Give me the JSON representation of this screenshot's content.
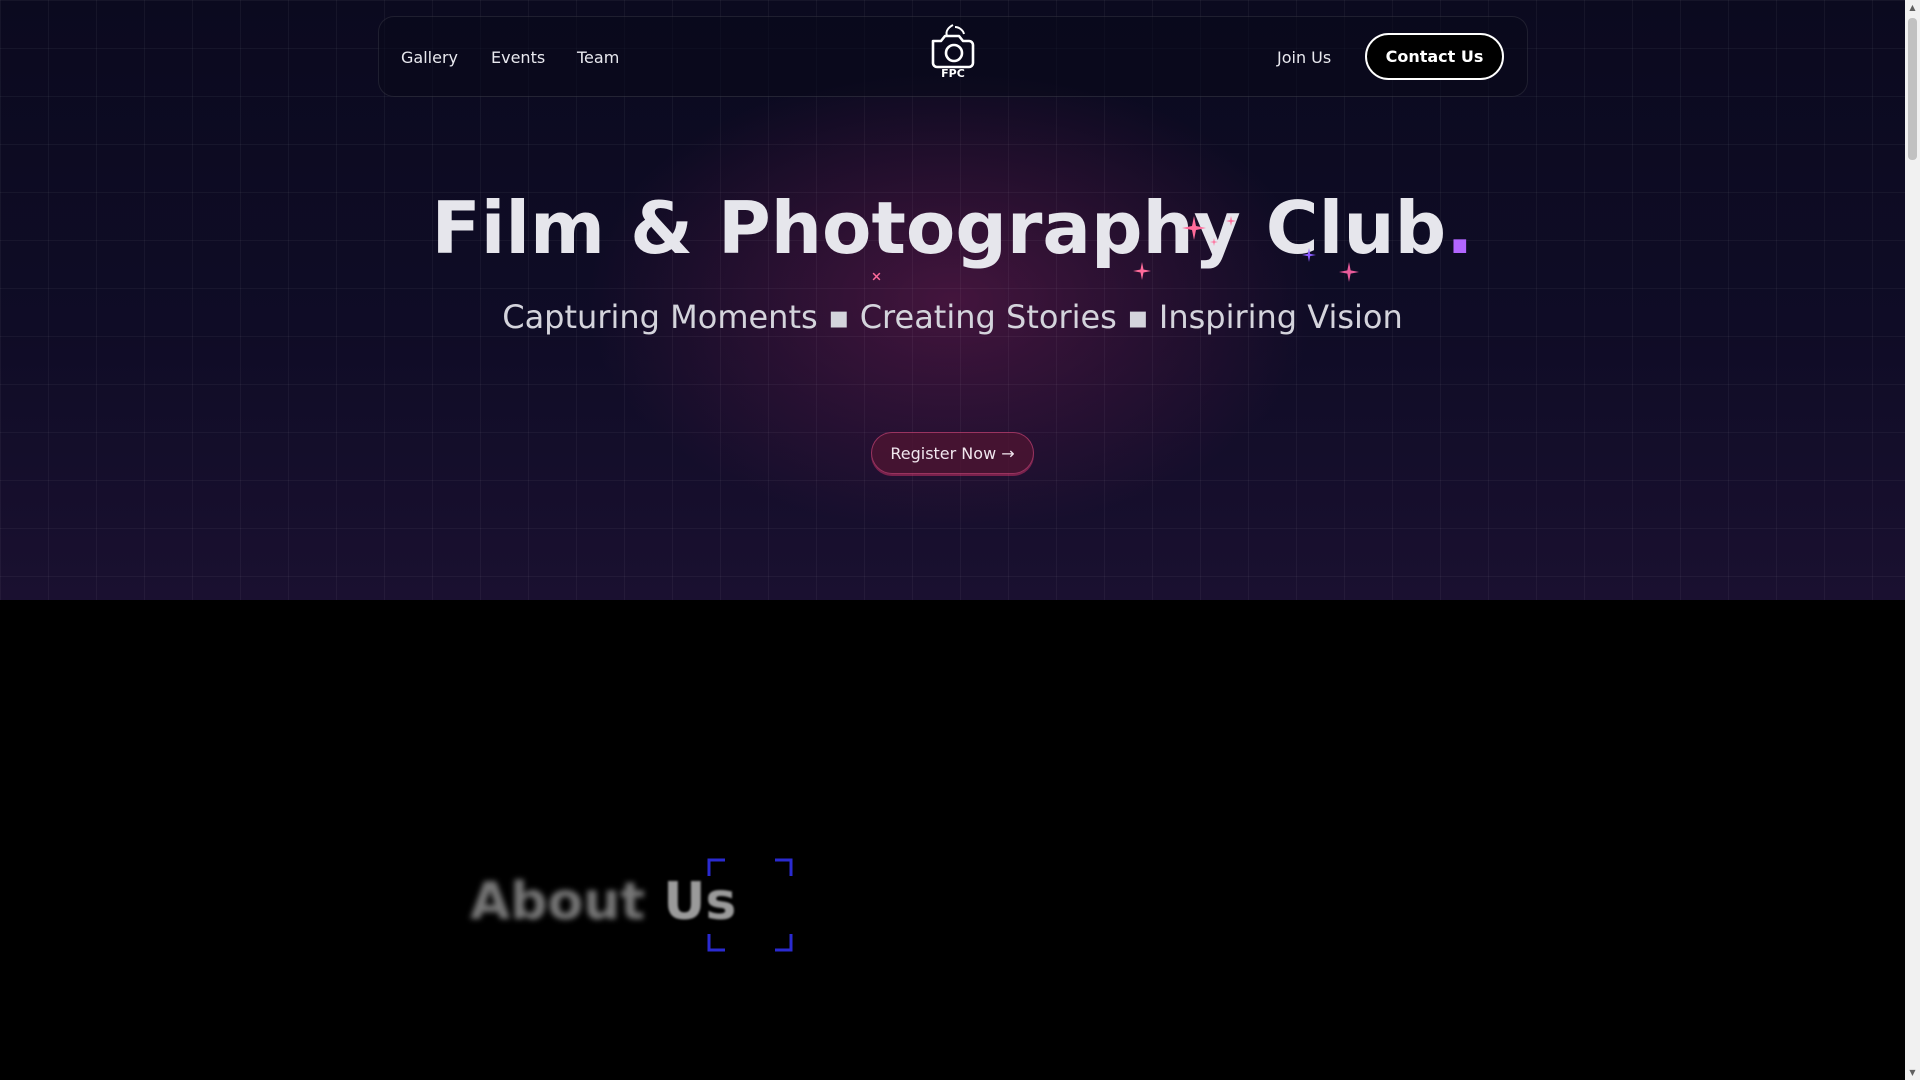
{
  "nav": {
    "gallery": "Gallery",
    "events": "Events",
    "team": "Team",
    "join": "Join Us",
    "contact": "Contact Us",
    "logo_text": "FPC"
  },
  "hero": {
    "title": "Film & Photography Club",
    "title_dot": ".",
    "subtitle": "Capturing Moments ▪ Creating Stories ▪ Inspiring Vision",
    "register": "Register Now →"
  },
  "about": {
    "word1": "About",
    "word2": "Us"
  },
  "icons": {
    "logo": "camera-icon",
    "sparkles": "sparkle-icon",
    "focus": "focus-bracket-icon"
  },
  "colors": {
    "accent": "#b266ff",
    "sparkle_pink": "#ff6b9a",
    "bracket_blue": "#2a2ad0"
  }
}
